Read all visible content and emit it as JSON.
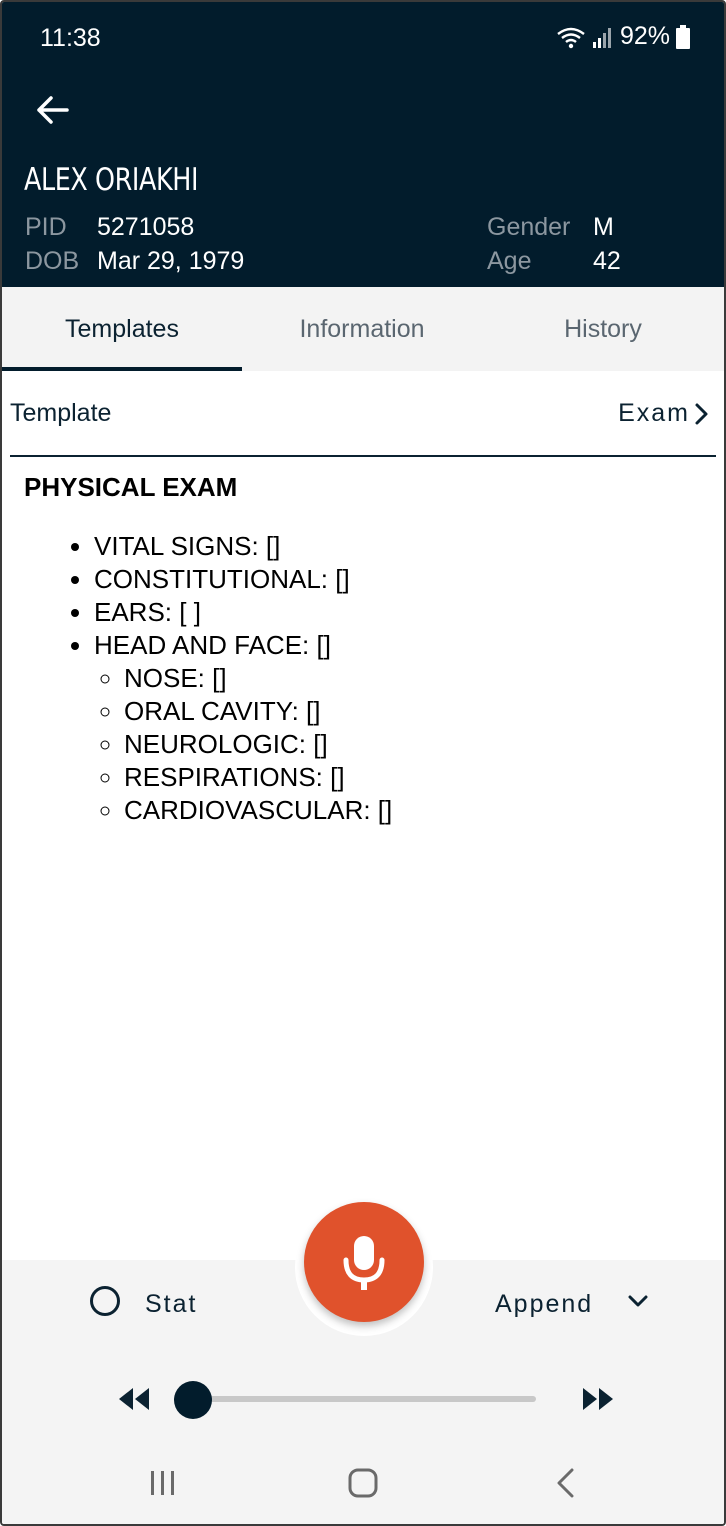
{
  "status_bar": {
    "time": "11:38",
    "battery": "92%"
  },
  "patient": {
    "name": "ALEX ORIAKHI",
    "pid_label": "PID",
    "pid": "5271058",
    "dob_label": "DOB",
    "dob": "Mar 29, 1979",
    "gender_label": "Gender",
    "gender": "M",
    "age_label": "Age",
    "age": "42"
  },
  "tabs": [
    {
      "label": "Templates",
      "active": true
    },
    {
      "label": "Information",
      "active": false
    },
    {
      "label": "History",
      "active": false
    }
  ],
  "template": {
    "label": "Template",
    "value": "Exam"
  },
  "exam": {
    "title": "PHYSICAL EXAM",
    "items": [
      "VITAL SIGNS: []",
      "CONSTITUTIONAL: []",
      "EARS: [ ]",
      "HEAD AND FACE: []"
    ],
    "sub_items": [
      "NOSE: []",
      "ORAL CAVITY: []",
      "NEUROLOGIC: []",
      "RESPIRATIONS: []",
      "CARDIOVASCULAR: []"
    ]
  },
  "controls": {
    "stat_label": "Stat",
    "append_label": "Append",
    "playback_position": 0
  },
  "colors": {
    "header_bg": "#021c2c",
    "mic": "#e0522c"
  },
  "icons": [
    "back-arrow-icon",
    "wifi-icon",
    "signal-icon",
    "battery-icon",
    "chevron-right-icon",
    "chevron-down-icon",
    "microphone-icon",
    "rewind-icon",
    "fast-forward-icon",
    "recents-icon",
    "home-icon",
    "nav-back-icon"
  ]
}
